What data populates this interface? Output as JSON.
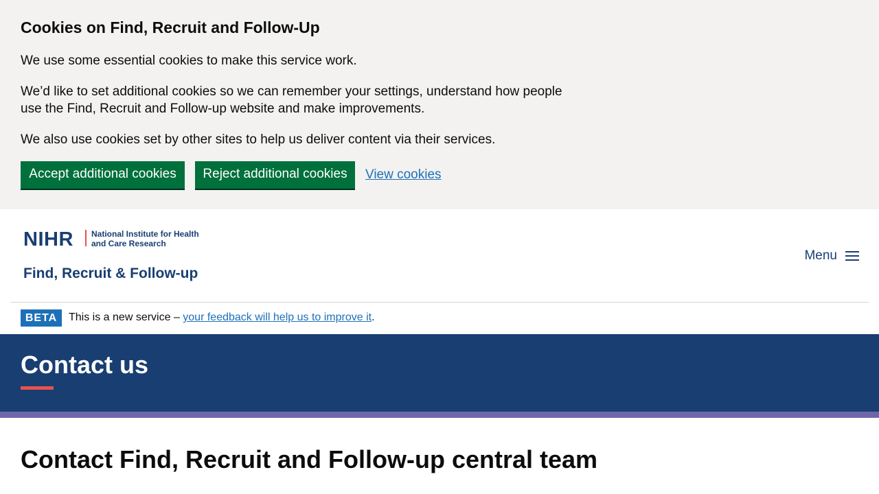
{
  "cookie_banner": {
    "title": "Cookies on Find, Recruit and Follow-Up",
    "paragraph_1": "We use some essential cookies to make this service work.",
    "paragraph_2": "We’d like to set additional cookies so we can remember your settings, understand how people use the Find, Recruit and Follow-up website and make improvements.",
    "paragraph_3": "We also use cookies set by other sites to help us deliver content via their services.",
    "accept_label": "Accept additional cookies",
    "reject_label": "Reject additional cookies",
    "view_label": "View cookies"
  },
  "header": {
    "logo_mark": "NIHR",
    "logo_org": "National Institute for Health and Care Research",
    "service_name": "Find, Recruit & Follow-up",
    "menu_label": "Menu"
  },
  "beta": {
    "tag": "BETA",
    "text_before": "This is a new service – ",
    "link": "your feedback will help us to improve it",
    "text_after": "."
  },
  "page": {
    "title": "Contact us",
    "heading": "Contact Find, Recruit and Follow-up central team"
  },
  "colors": {
    "brand_navy": "#193e72",
    "button_green": "#00703c",
    "link_blue": "#1d70b8",
    "accent_red": "#e8524b",
    "strip_purple": "#6e68ab"
  }
}
